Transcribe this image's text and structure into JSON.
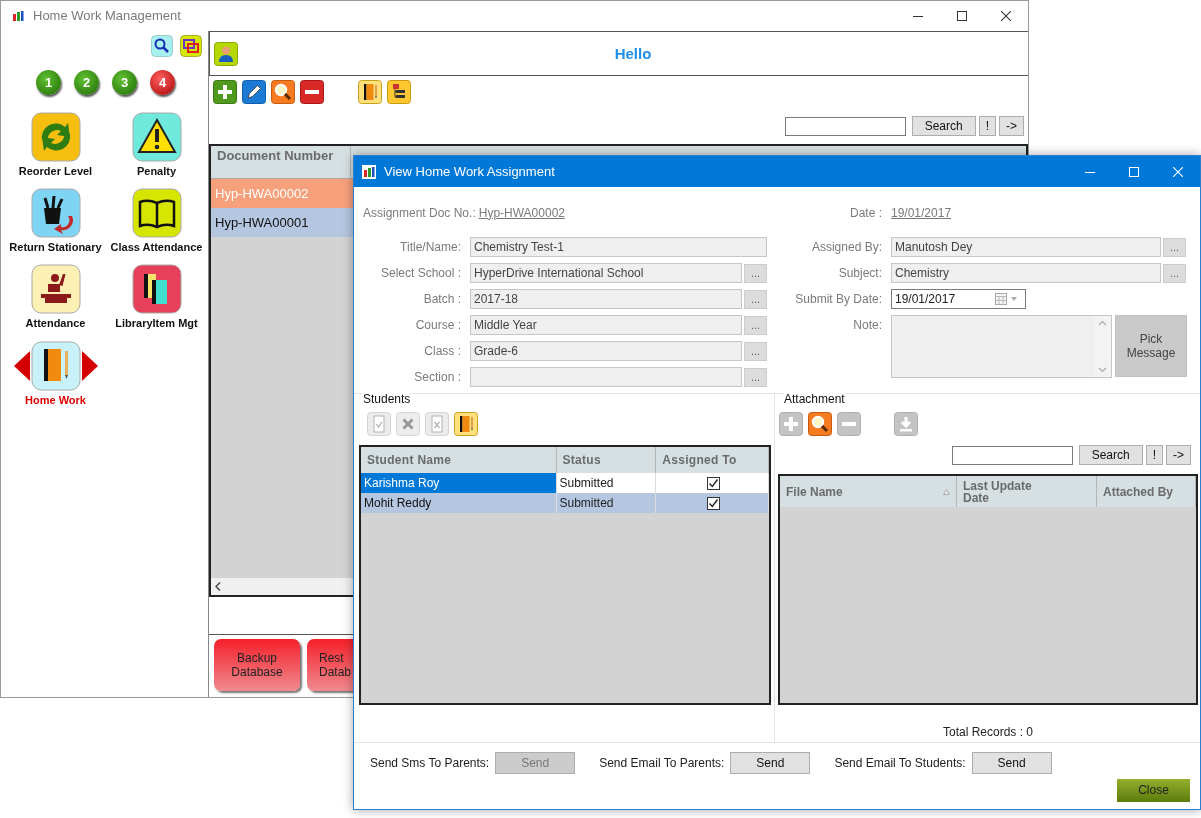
{
  "main_window": {
    "title": "Home Work Management",
    "sidebar": {
      "pages": [
        {
          "label": "1",
          "selected": false
        },
        {
          "label": "2",
          "selected": false
        },
        {
          "label": "3",
          "selected": false
        },
        {
          "label": "4",
          "selected": true
        }
      ],
      "modules": [
        {
          "label": "Reorder Level",
          "selected": false
        },
        {
          "label": "Penalty",
          "selected": false
        },
        {
          "label": "Return Stationary",
          "selected": false
        },
        {
          "label": "Class Attendance",
          "selected": false
        },
        {
          "label": "Attendance",
          "selected": false
        },
        {
          "label": "LibraryItem Mgt",
          "selected": false
        },
        {
          "label": "Home Work",
          "selected": true
        }
      ]
    },
    "header": {
      "greeting": "Hello"
    },
    "search": {
      "button": "Search",
      "clear": "!",
      "go": "->"
    },
    "table": {
      "columns": [
        "Document Number"
      ],
      "rows": [
        {
          "document_number": "Hyp-HWA00002",
          "selected": true
        },
        {
          "document_number": "Hyp-HWA00001",
          "selected": false
        }
      ]
    },
    "footer_buttons": [
      "Backup Database",
      "Rest Datab"
    ]
  },
  "dialog": {
    "title": "View Home Work Assignment",
    "doc_no": {
      "label": "Assignment Doc No.:",
      "value": "Hyp-HWA00002"
    },
    "date": {
      "label": "Date :",
      "value": "19/01/2017"
    },
    "left_fields": [
      {
        "label": "Title/Name:",
        "value": "Chemistry Test-1",
        "kind": "text"
      },
      {
        "label": "Select School :",
        "value": "HyperDrive International School",
        "kind": "lookup",
        "button": "..."
      },
      {
        "label": "Batch :",
        "value": "2017-18",
        "kind": "lookup",
        "button": "..."
      },
      {
        "label": "Course :",
        "value": "Middle Year",
        "kind": "lookup",
        "button": "..."
      },
      {
        "label": "Class :",
        "value": "Grade-6",
        "kind": "lookup",
        "button": "..."
      },
      {
        "label": "Section :",
        "kind": "lookup",
        "button": "..."
      }
    ],
    "right_fields": [
      {
        "label": "Assigned By:",
        "value": "Manutosh Dey",
        "kind": "lookup",
        "button": "..."
      },
      {
        "label": "Subject:",
        "value": "Chemistry",
        "kind": "lookup",
        "button": "..."
      },
      {
        "label": "Submit By Date:",
        "value": "19/01/2017",
        "kind": "date"
      },
      {
        "label": "Note:",
        "kind": "note",
        "button": "Pick Message"
      }
    ],
    "students": {
      "legend": "Students",
      "toolbar": [
        {
          "disabled": true
        },
        {
          "disabled": true
        },
        {
          "disabled": true
        },
        {
          "disabled": false
        }
      ],
      "columns": [
        "Student Name",
        "Status",
        "Assigned To"
      ],
      "rows": [
        {
          "student_name": "Karishma Roy",
          "status": "Submitted",
          "assigned": true,
          "selected": true
        },
        {
          "student_name": "Mohit Reddy",
          "status": "Submitted",
          "assigned": true,
          "selected": false
        }
      ]
    },
    "attachment": {
      "legend": "Attachment",
      "toolbar": [
        {
          "disabled": true
        },
        {
          "disabled": false
        },
        {
          "disabled": true
        },
        {
          "disabled": true
        }
      ],
      "search": {
        "button": "Search",
        "clear": "!",
        "go": "->"
      },
      "columns": [
        {
          "label": "File Name",
          "sorted": true
        },
        {
          "label": "Last Update Date",
          "sorted": false
        },
        {
          "label": "Attached By",
          "sorted": false
        }
      ],
      "total": "Total Records : 0"
    },
    "notifications": [
      {
        "label": "Send Sms To Parents:",
        "button": "Send",
        "disabled": true
      },
      {
        "label": "Send Email To Parents:",
        "button": "Send",
        "disabled": false
      },
      {
        "label": "Send Email To Students:",
        "button": "Send",
        "disabled": false
      }
    ],
    "close_button": "Close"
  }
}
